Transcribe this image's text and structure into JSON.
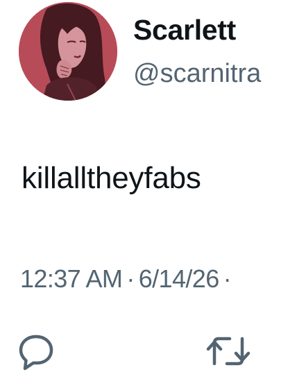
{
  "author": {
    "display_name": "Scarlett",
    "handle": "@scarnitra",
    "avatar_icon": "profile-avatar-illustration"
  },
  "tweet": {
    "text": "killalltheyfabs",
    "time": "12:37 AM",
    "separator": "·",
    "date": "6/14/26",
    "trailing_separator": "·"
  },
  "actions": {
    "reply_icon": "reply-bubble-icon",
    "retweet_icon": "retweet-icon"
  },
  "colors": {
    "text_primary": "#0f1419",
    "text_secondary": "#536471",
    "avatar_bg": "#b8505a"
  }
}
